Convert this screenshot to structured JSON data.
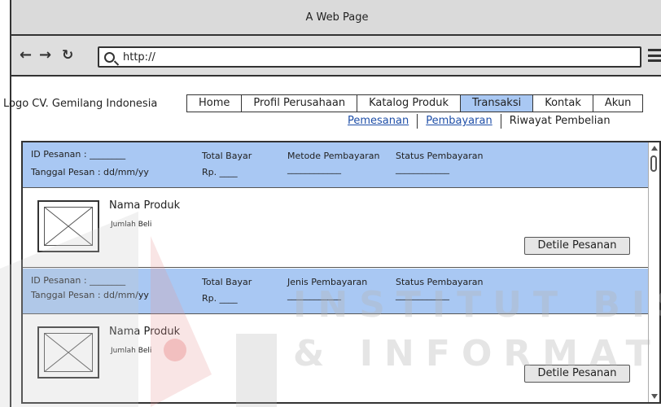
{
  "window": {
    "title": "A Web Page"
  },
  "browser": {
    "url": "http://",
    "back_icon": "arrow-left",
    "forward_icon": "arrow-right",
    "refresh_icon": "refresh",
    "search_icon": "search",
    "menu_icon": "hamburger"
  },
  "header": {
    "logo": "Logo CV. Gemilang Indonesia",
    "menu": [
      {
        "label": "Home",
        "active": false
      },
      {
        "label": "Profil Perusahaan",
        "active": false
      },
      {
        "label": "Katalog Produk",
        "active": false
      },
      {
        "label": "Transaksi",
        "active": true
      },
      {
        "label": "Kontak",
        "active": false
      },
      {
        "label": "Akun",
        "active": false
      }
    ],
    "submenu": [
      {
        "label": "Pemesanan",
        "link": true
      },
      {
        "label": "Pembayaran",
        "link": true
      },
      {
        "label": "Riwayat Pembelian",
        "link": false
      }
    ]
  },
  "orders": [
    {
      "id_label": "ID Pesanan : ________",
      "date_label": "Tanggal Pesan : dd/mm/yy",
      "total_label": "Total Bayar",
      "total_value": "Rp. ____",
      "method_label": "Metode Pembayaran",
      "method_value": "____________",
      "status_label": "Status Pembayaran",
      "status_value": "____________",
      "product_name": "Nama Produk",
      "product_qty": "Jumlah Beli",
      "detail_button": "Detile Pesanan"
    },
    {
      "id_label": "ID Pesanan : ________",
      "date_label": "Tanggal Pesan : dd/mm/yy",
      "total_label": "Total Bayar",
      "total_value": "Rp. ____",
      "method_label": "Jenis Pembayaran",
      "method_value": "____________",
      "status_label": "Status Pembayaran",
      "status_value": "____________",
      "product_name": "Nama Produk",
      "product_qty": "Jumlah Beli",
      "detail_button": "Detile Pesanan"
    }
  ],
  "colors": {
    "accent_blue": "#a9c8f3",
    "link_blue": "#1f4fa8",
    "titlebar_gray": "#dadada",
    "button_gray": "#e6e6e6"
  },
  "watermark": {
    "line1": "INSTITUT BISN",
    "line2": "& INFORMATI"
  }
}
